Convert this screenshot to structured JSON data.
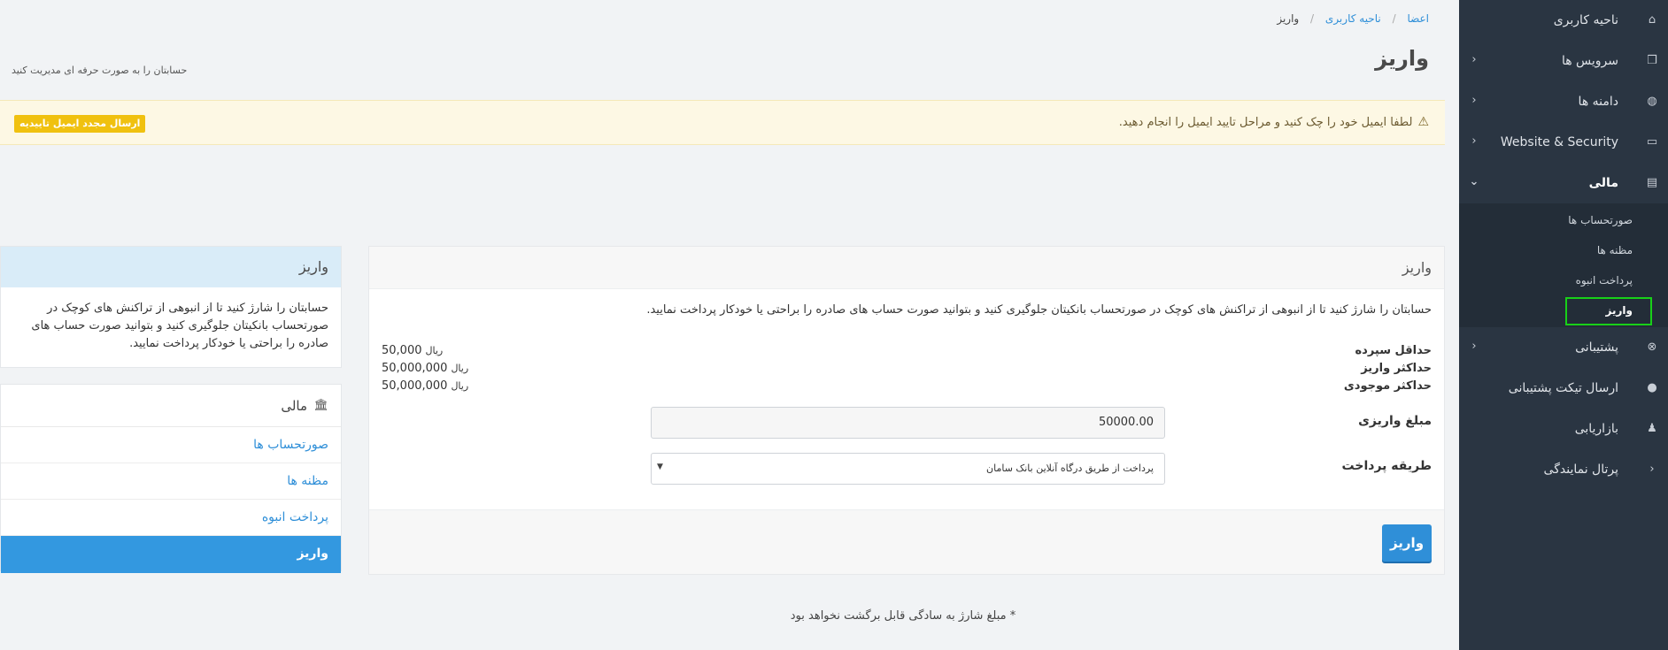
{
  "sidebar": {
    "items": [
      {
        "label": "ناحیه کاربری",
        "icon": "home-icon",
        "glyph": "⌂",
        "chevron": ""
      },
      {
        "label": "سرویس ها",
        "icon": "cube-icon",
        "glyph": "❒",
        "chevron": "‹"
      },
      {
        "label": "دامنه ها",
        "icon": "globe-icon",
        "glyph": "◍",
        "chevron": "‹"
      },
      {
        "label": "Website & Security",
        "icon": "monitor-icon",
        "glyph": "▭",
        "chevron": "‹"
      },
      {
        "label": "مالی",
        "icon": "file-icon",
        "glyph": "▤",
        "chevron": "⌄"
      }
    ],
    "finance_sub": [
      "صورتحساب ها",
      "مظنه ها",
      "پرداخت انبوه",
      "واریز"
    ],
    "items_after": [
      {
        "label": "پشتیبانی",
        "icon": "life-ring-icon",
        "glyph": "⊗",
        "chevron": "‹"
      },
      {
        "label": "ارسال تیکت پشتیبانی",
        "icon": "comment-icon",
        "glyph": "●",
        "chevron": ""
      },
      {
        "label": "بازاریابی",
        "icon": "users-icon",
        "glyph": "♟",
        "chevron": ""
      },
      {
        "label": "پرتال نمایندگی",
        "icon": "chevron-left-icon",
        "glyph": "‹",
        "chevron": ""
      }
    ]
  },
  "breadcrumb": {
    "b1": "اعضا",
    "b2": "ناحیه کاربری",
    "b3": "واریز"
  },
  "page": {
    "title": "واریز",
    "subtitle": "حسابتان را به صورت حرفه ای مدیریت کنید"
  },
  "alert": {
    "text": "لطفا ایمیل خود را چک کنید و مراحل تایید ایمیل را انجام دهید.",
    "button": "ارسال مجدد ایمیل تاییدیه"
  },
  "deposit": {
    "heading": "واریز",
    "description": "حسابتان را شارژ کنید تا از انبوهی از تراکنش های کوچک در صورتحساب بانکیتان جلوگیری کنید و بتوانید صورت حساب های صادره را براحتی یا خودکار پرداخت نمایید.",
    "limits": [
      {
        "label": "حداقل سپرده",
        "value": "50,000",
        "currency": "ریال"
      },
      {
        "label": "حداکثر واریز",
        "value": "50,000,000",
        "currency": "ریال"
      },
      {
        "label": "حداکثر موجودی",
        "value": "50,000,000",
        "currency": "ریال"
      }
    ],
    "amount_label": "مبلغ واریزی",
    "amount_value": "50000.00",
    "method_label": "طریقه پرداخت",
    "method_value": "پرداخت از طریق درگاه آنلاین بانک سامان",
    "button": "واریز"
  },
  "footnote": "* مبلغ شارژ به سادگی قابل برگشت نخواهد بود",
  "info": {
    "heading": "واریز",
    "text": "حسابتان را شارژ کنید تا از انبوهی از تراکنش های کوچک در صورتحساب بانکیتان جلوگیری کنید و بتوانید صورت حساب های صادره را براحتی یا خودکار پرداخت نمایید."
  },
  "menu": {
    "heading": "مالی",
    "items": [
      "صورتحساب ها",
      "مظنه ها",
      "پرداخت انبوه",
      "واریز"
    ]
  },
  "colors": {
    "accent": "#2f8fd8",
    "sidebar": "#2a3542",
    "warning_button": "#f0c10f",
    "highlight": "#18d018"
  }
}
